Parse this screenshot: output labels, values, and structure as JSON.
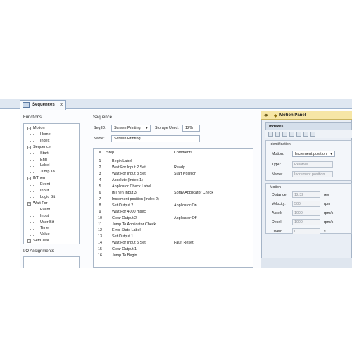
{
  "tab": {
    "title": "Sequences",
    "close": "✕"
  },
  "functions": {
    "header": "Functions",
    "tree": [
      {
        "label": "Motion",
        "level": 0,
        "expander": "−"
      },
      {
        "label": "Home",
        "level": 1
      },
      {
        "label": "Index",
        "level": 1
      },
      {
        "label": "Sequence",
        "level": 0,
        "expander": "−"
      },
      {
        "label": "Start",
        "level": 1
      },
      {
        "label": "End",
        "level": 1
      },
      {
        "label": "Label",
        "level": 1
      },
      {
        "label": "Jump To",
        "level": 1
      },
      {
        "label": "If/Then",
        "level": 0,
        "expander": "−"
      },
      {
        "label": "Event",
        "level": 1
      },
      {
        "label": "Input",
        "level": 1
      },
      {
        "label": "Logic Bit",
        "level": 1
      },
      {
        "label": "Wait For",
        "level": 0,
        "expander": "−"
      },
      {
        "label": "Event",
        "level": 1
      },
      {
        "label": "Input",
        "level": 1
      },
      {
        "label": "User Bit",
        "level": 1
      },
      {
        "label": "Time",
        "level": 1
      },
      {
        "label": "Value",
        "level": 1
      },
      {
        "label": "Set/Clear",
        "level": 0,
        "expander": "+"
      }
    ]
  },
  "io": {
    "header": "I/O Assignments"
  },
  "sequence": {
    "header": "Sequence",
    "seq_id_label": "Seq ID:",
    "seq_id_value": "Screen Printing",
    "storage_label": "Storage Used:",
    "storage_value": "12%",
    "name_label": "Name:",
    "name_value": "Screen Printing",
    "columns": {
      "num": "#",
      "step": "Step",
      "comments": "Comments"
    },
    "rows": [
      {
        "n": "1",
        "step": "Begin Label",
        "comment": ""
      },
      {
        "n": "2",
        "step": "Wait For Input 2 Set",
        "comment": "Ready"
      },
      {
        "n": "3",
        "step": "Wait For Input 3 Set",
        "comment": "Start Position"
      },
      {
        "n": "4",
        "step": "Absolute (Index 1)",
        "comment": ""
      },
      {
        "n": "5",
        "step": "Applicator Check Label",
        "comment": ""
      },
      {
        "n": "6",
        "step": "If/Then Input 3",
        "comment": "Spray Applicator Check"
      },
      {
        "n": "7",
        "step": "Increment position (Index 2)",
        "comment": ""
      },
      {
        "n": "8",
        "step": "Set Output 2",
        "comment": "Applicator On"
      },
      {
        "n": "9",
        "step": "Wait For 4000 msec",
        "comment": ""
      },
      {
        "n": "10",
        "step": "Clear Output 2",
        "comment": "Applicator Off"
      },
      {
        "n": "11",
        "step": "Jump To Applicator Check",
        "comment": ""
      },
      {
        "n": "12",
        "step": "Error State Label",
        "comment": ""
      },
      {
        "n": "13",
        "step": "Set Output 1",
        "comment": ""
      },
      {
        "n": "14",
        "step": "Wait For Input 5 Set",
        "comment": "Fault Reset"
      },
      {
        "n": "15",
        "step": "Clear Output 1",
        "comment": ""
      },
      {
        "n": "16",
        "step": "Jump To Begin",
        "comment": ""
      }
    ]
  },
  "motion_panel": {
    "title": "Motion Panel",
    "indexes_label": "Indexes",
    "identification": {
      "header": "Identification",
      "motion_label": "Motion:",
      "motion_value": "Increment position",
      "type_label": "Type:",
      "type_value": "Relative",
      "name_label": "Name:",
      "name_value": "Increment position"
    },
    "motion": {
      "header": "Motion",
      "fields": [
        {
          "label": "Distance:",
          "value": "12.32",
          "unit": "rev"
        },
        {
          "label": "Velocity:",
          "value": "500",
          "unit": "rpm"
        },
        {
          "label": "Accel:",
          "value": "1000",
          "unit": "rpm/s"
        },
        {
          "label": "Decel:",
          "value": "1000",
          "unit": "rpm/s"
        },
        {
          "label": "Dwell:",
          "value": "0",
          "unit": "s"
        }
      ]
    }
  },
  "colors": {
    "panel_header": "#f6e6a6",
    "tab_strip": "#dfe7f1",
    "border": "#a9b7c8"
  }
}
